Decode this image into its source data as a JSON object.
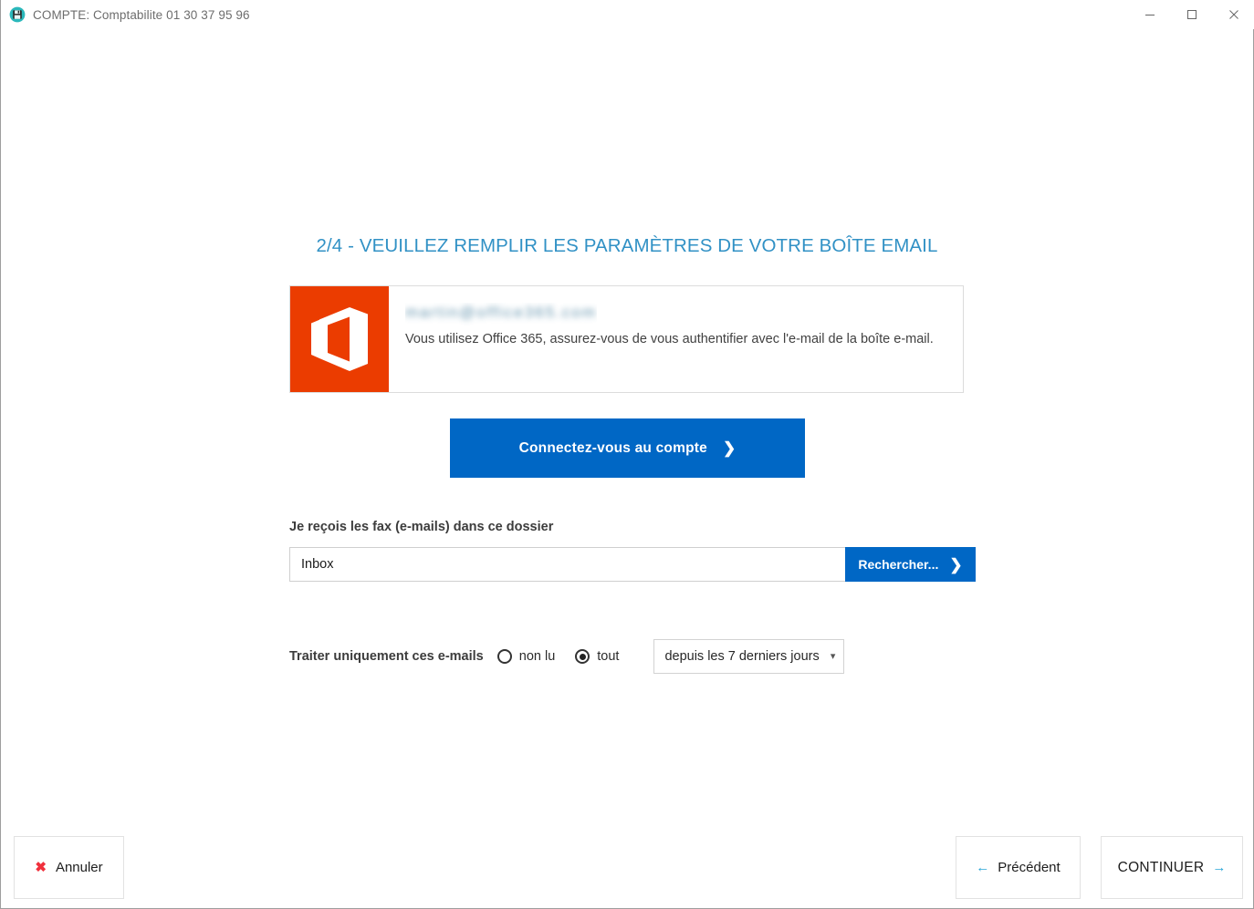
{
  "window": {
    "title": "COMPTE: Comptabilite 01 30 37 95 96",
    "app_icon": "floppy-disk-teal-icon",
    "controls": {
      "minimize": "minimize-icon",
      "maximize": "maximize-icon",
      "close": "close-icon"
    }
  },
  "page": {
    "title": "2/4 - VEUILLEZ REMPLIR LES PARAMÈTRES DE VOTRE BOÎTE EMAIL",
    "title_color": "#3191c5"
  },
  "info_box": {
    "logo": "office-365-logo",
    "logo_background": "#eb3c00",
    "account_email_blurred": "martin@office365.com",
    "message": "Vous utilisez Office 365, assurez-vous de vous authentifier avec l'e-mail de la boîte e-mail."
  },
  "connect": {
    "label": "Connectez-vous au compte",
    "chevron": "chevron-right-icon",
    "color": "#0067c5"
  },
  "folder": {
    "label": "Je reçois les fax (e-mails) dans ce dossier",
    "value": "Inbox",
    "placeholder": "Inbox",
    "search_label": "Rechercher...",
    "search_chevron": "chevron-right-icon"
  },
  "filter": {
    "label": "Traiter uniquement ces e-mails",
    "options": [
      {
        "label": "non lu",
        "checked": false
      },
      {
        "label": "tout",
        "checked": true
      }
    ],
    "period": {
      "selected": "depuis les 7 derniers jours",
      "caret": "chevron-down-icon"
    }
  },
  "footer": {
    "cancel": {
      "label": "Annuler",
      "icon": "x-mark-icon",
      "icon_color": "#f0303c"
    },
    "previous": {
      "label": "Précédent",
      "icon": "arrow-left-icon",
      "icon_color": "#29a6d8"
    },
    "continue": {
      "label": "CONTINUER",
      "icon": "arrow-right-icon",
      "icon_color": "#29a6d8"
    }
  }
}
